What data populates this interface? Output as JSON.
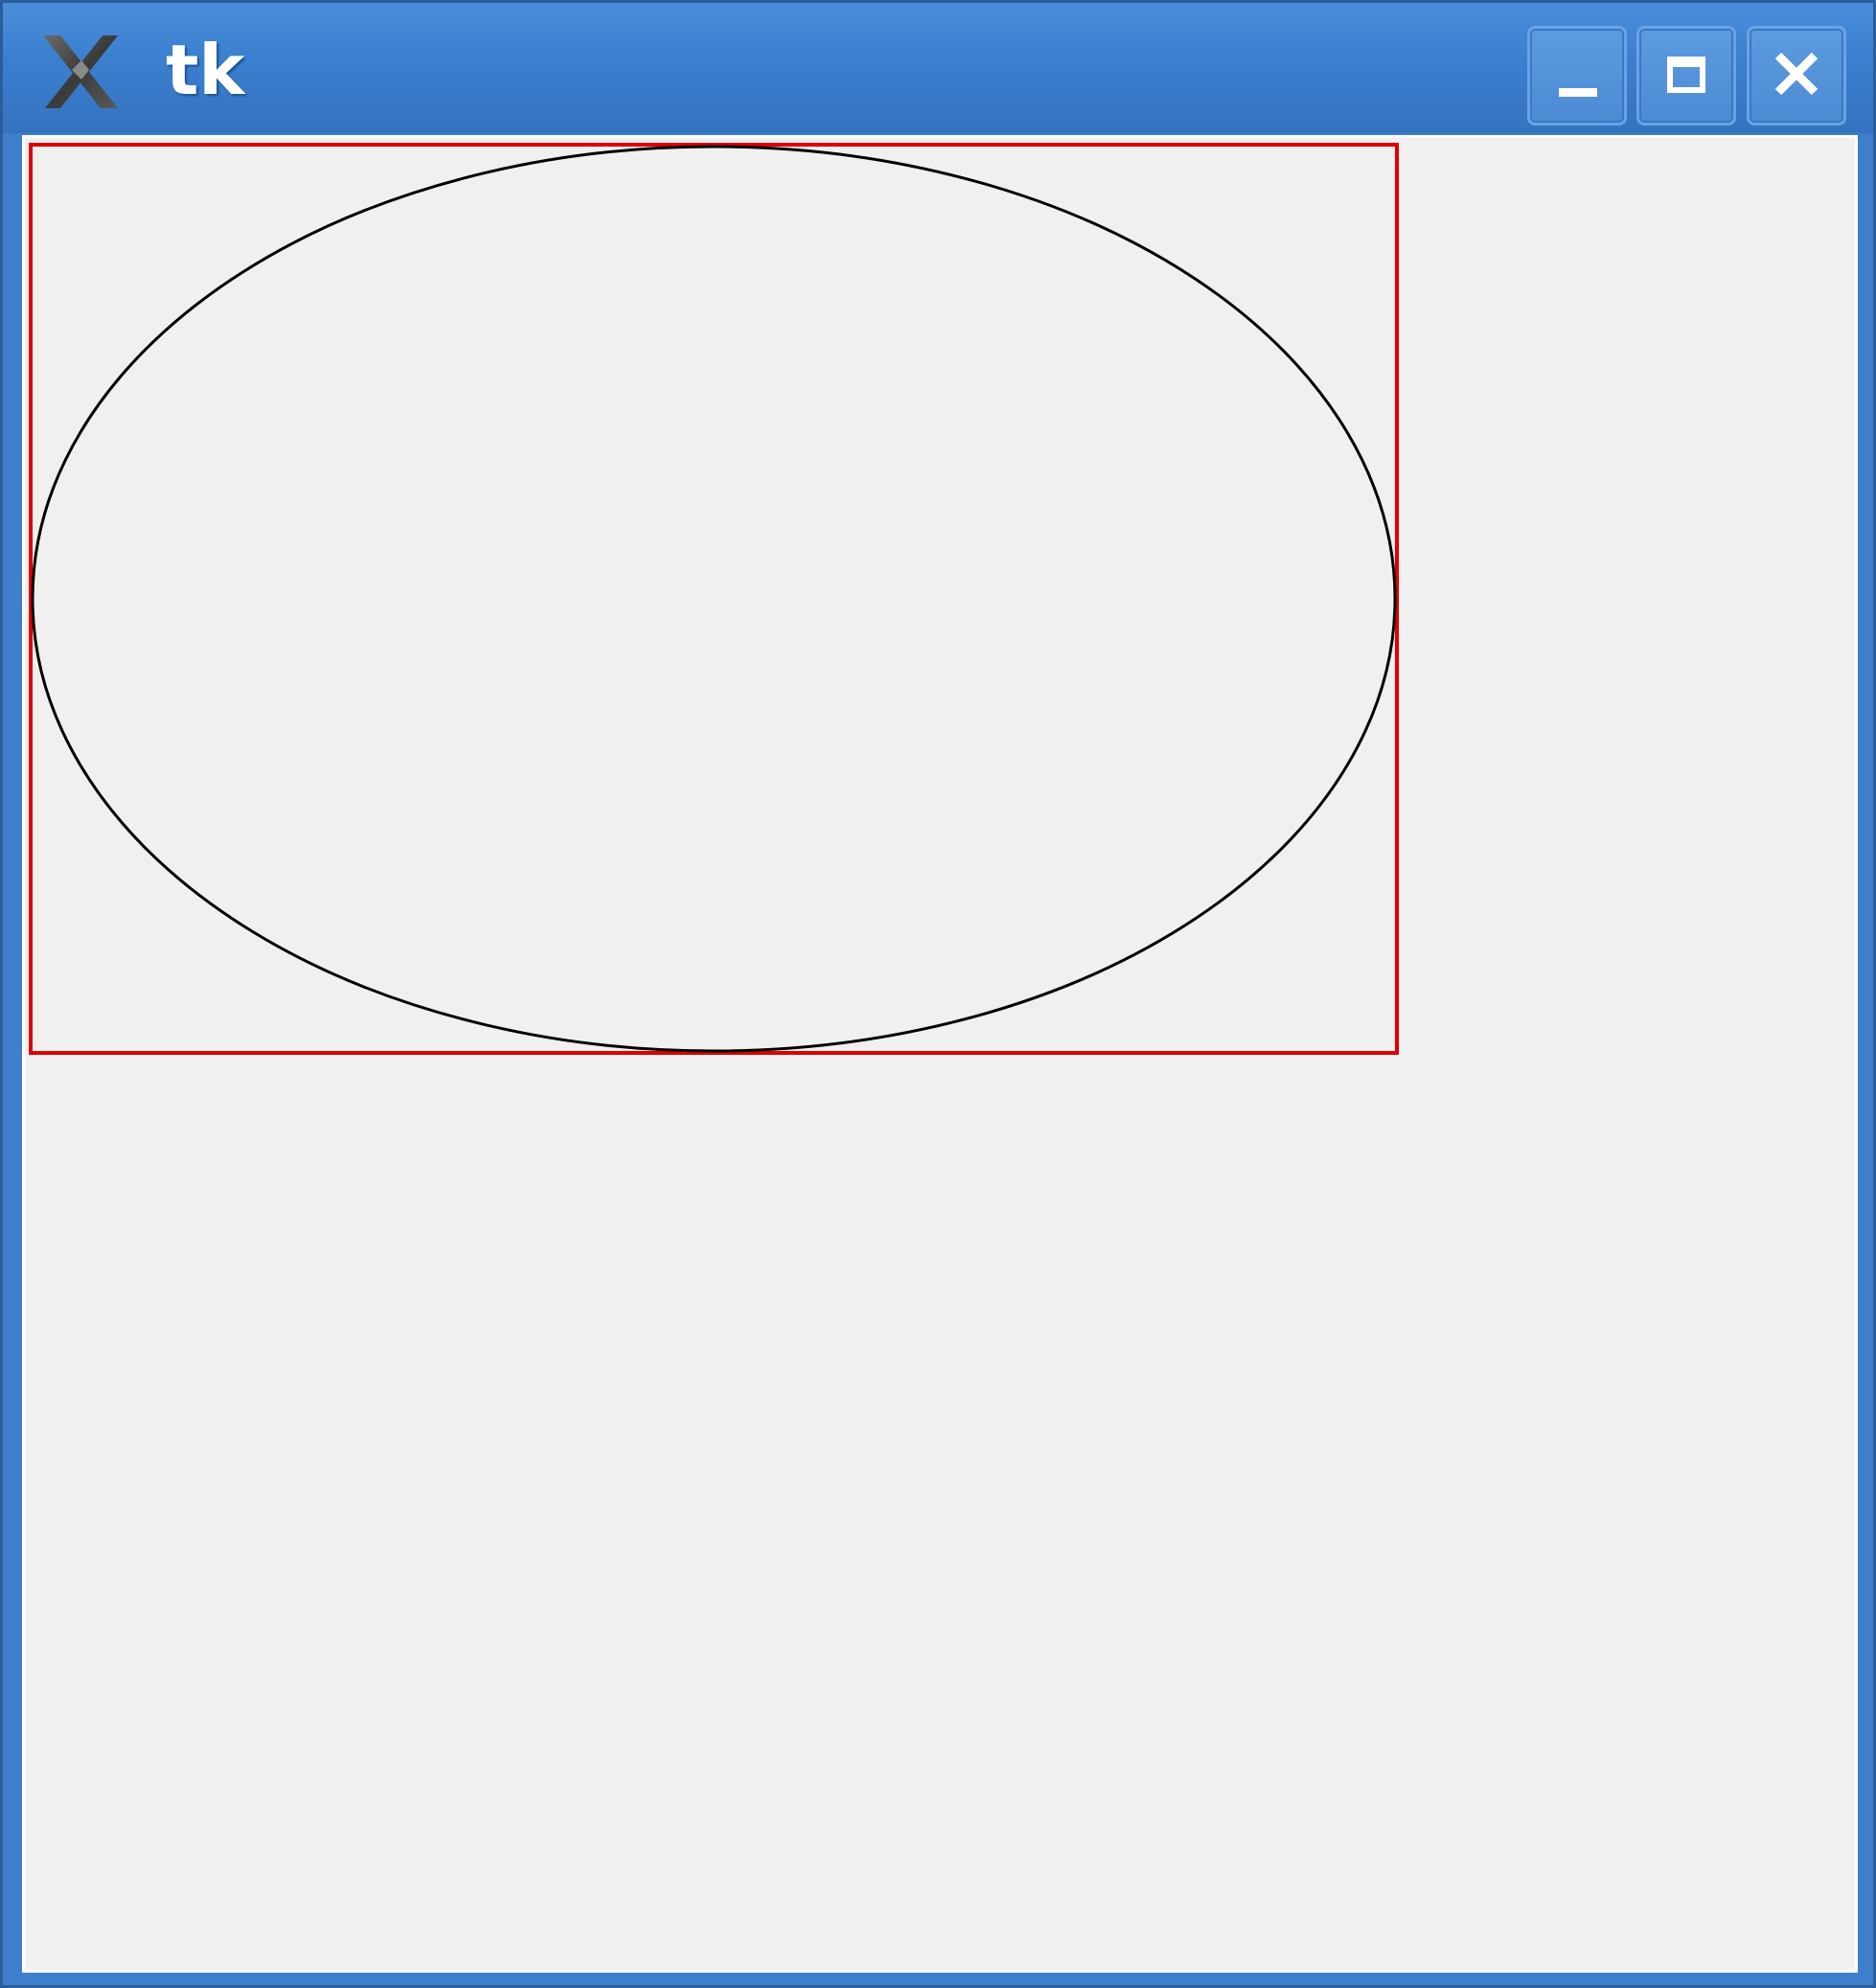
{
  "window": {
    "title": "tk",
    "app_icon": "x-logo-icon",
    "controls": {
      "minimize_icon": "minimize-icon",
      "maximize_icon": "maximize-icon",
      "close_icon": "close-icon"
    }
  },
  "canvas": {
    "shapes": [
      {
        "kind": "rectangle",
        "outline": "#e00000"
      },
      {
        "kind": "oval",
        "outline": "#000000"
      }
    ]
  },
  "colors": {
    "titlebar": "#3a7fcf",
    "background": "#f0f0f0",
    "rectangle_outline": "#e00000",
    "oval_outline": "#000000"
  }
}
